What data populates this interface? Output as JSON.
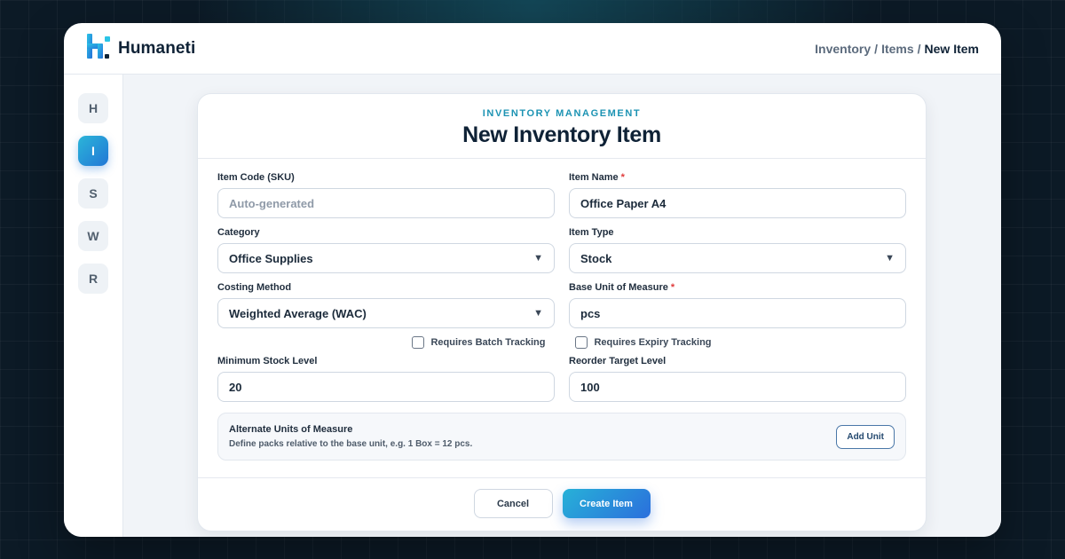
{
  "app": {
    "name": "Humaneti",
    "logo_icon": "humaneti-logo-icon"
  },
  "breadcrumb": {
    "items": [
      "Inventory",
      "Items"
    ],
    "current": "New Item",
    "separator": "/"
  },
  "sidebar": {
    "items": [
      {
        "label": "H",
        "active": false
      },
      {
        "label": "I",
        "active": true
      },
      {
        "label": "S",
        "active": false
      },
      {
        "label": "W",
        "active": false
      },
      {
        "label": "R",
        "active": false
      }
    ]
  },
  "form": {
    "eyebrow": "INVENTORY MANAGEMENT",
    "title": "New Inventory Item",
    "item_code": {
      "label": "Item Code (SKU)",
      "placeholder": "Auto-generated",
      "value": ""
    },
    "item_name": {
      "label": "Item Name",
      "required_mark": "*",
      "value": "Office Paper A4"
    },
    "category": {
      "label": "Category",
      "value": "Office Supplies",
      "caret": "▼"
    },
    "item_type": {
      "label": "Item Type",
      "value": "Stock",
      "caret": "▼"
    },
    "costing_method": {
      "label": "Costing Method",
      "value": "Weighted Average (WAC)",
      "caret": "▼"
    },
    "base_uom": {
      "label": "Base Unit of Measure",
      "required_mark": "*",
      "value": "pcs"
    },
    "batch_tracking": {
      "label": "Requires Batch Tracking",
      "checked": false
    },
    "expiry_tracking": {
      "label": "Requires Expiry Tracking",
      "checked": false
    },
    "min_stock": {
      "label": "Minimum Stock Level",
      "value": "20"
    },
    "reorder_target": {
      "label": "Reorder Target Level",
      "value": "100"
    },
    "alt_units": {
      "title": "Alternate Units of Measure",
      "description": "Define packs relative to the base unit, e.g. 1 Box = 12 pcs.",
      "add_label": "Add Unit"
    },
    "cancel_label": "Cancel",
    "create_label": "Create Item"
  },
  "colors": {
    "accent": "#2bb5d9",
    "accent_dark": "#2277d6",
    "required": "#e03b3b",
    "eyebrow": "#1c93b3"
  }
}
